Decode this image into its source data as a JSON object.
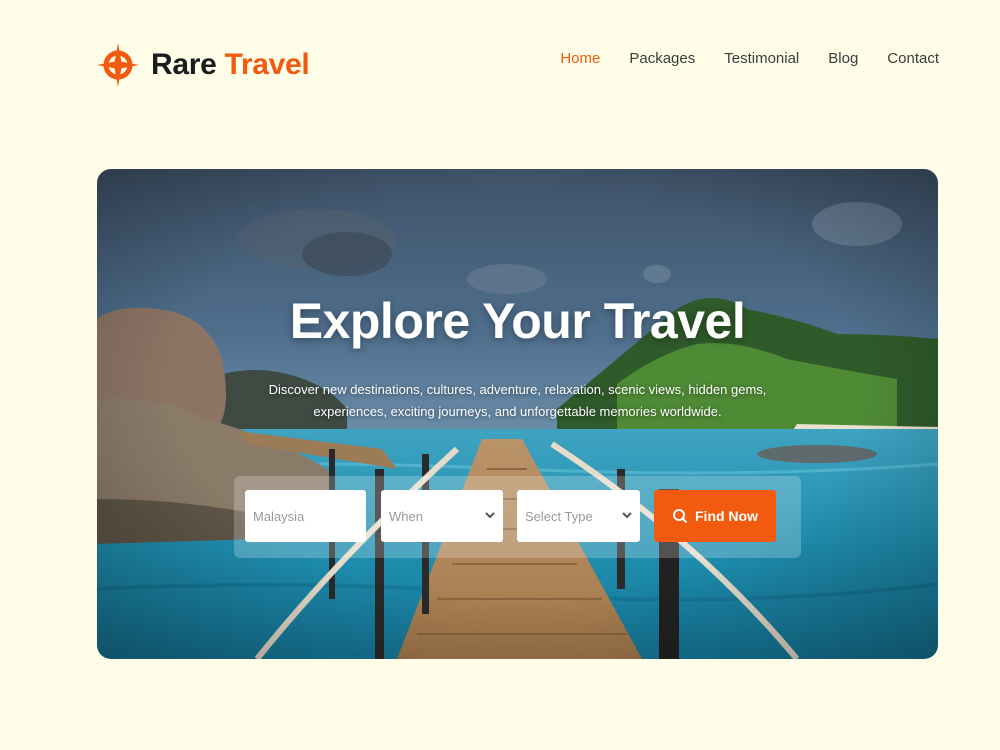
{
  "brand": {
    "name_part1": "Rare",
    "name_part2": "Travel",
    "logo_icon": "compass-cross-icon",
    "accent_color": "#f25a0f"
  },
  "nav": {
    "items": [
      {
        "label": "Home",
        "active": true
      },
      {
        "label": "Packages",
        "active": false
      },
      {
        "label": "Testimonial",
        "active": false
      },
      {
        "label": "Blog",
        "active": false
      },
      {
        "label": "Contact",
        "active": false
      }
    ]
  },
  "hero": {
    "title": "Explore Your Travel",
    "subtitle": "Discover new destinations, cultures, adventure, relaxation, scenic views, hidden gems, experiences, exciting journeys, and unforgettable memories worldwide."
  },
  "search": {
    "destination_placeholder": "Malaysia",
    "when_value": "When",
    "type_value": "Select Type",
    "button_label": "Find Now",
    "button_icon": "search-icon"
  }
}
